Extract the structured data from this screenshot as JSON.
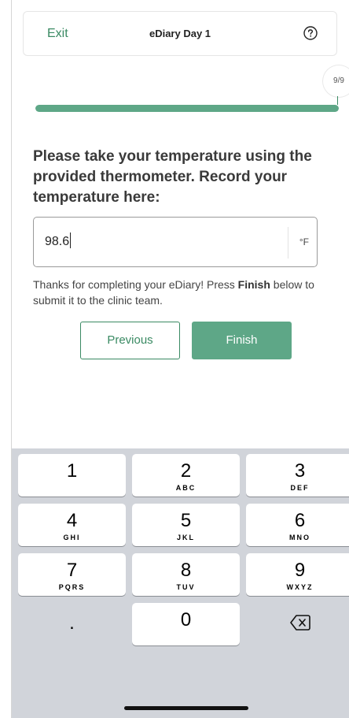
{
  "header": {
    "exit_label": "Exit",
    "title": "eDiary Day 1",
    "help_icon": "question-circle-icon"
  },
  "progress": {
    "label": "9/9",
    "fraction": 1.0,
    "color": "#5ea787"
  },
  "question": {
    "text": "Please take your temperature using the provided thermometer. Record your temperature here:"
  },
  "answer": {
    "value": "98.6",
    "unit": "°F"
  },
  "note": {
    "prefix": "Thanks for completing your eDiary! Press ",
    "bold": "Finish",
    "suffix": " below to submit it to the clinic team."
  },
  "buttons": {
    "previous": "Previous",
    "finish": "Finish"
  },
  "keyboard": {
    "keys": [
      {
        "digit": "1",
        "letters": ""
      },
      {
        "digit": "2",
        "letters": "ABC"
      },
      {
        "digit": "3",
        "letters": "DEF"
      },
      {
        "digit": "4",
        "letters": "GHI"
      },
      {
        "digit": "5",
        "letters": "JKL"
      },
      {
        "digit": "6",
        "letters": "MNO"
      },
      {
        "digit": "7",
        "letters": "PQRS"
      },
      {
        "digit": "8",
        "letters": "TUV"
      },
      {
        "digit": "9",
        "letters": "WXYZ"
      },
      {
        "digit": ".",
        "letters": ""
      },
      {
        "digit": "0",
        "letters": ""
      },
      {
        "digit": "",
        "letters": ""
      }
    ],
    "backspace_icon": "backspace-icon"
  },
  "colors": {
    "accent": "#3a8a63",
    "finish_button": "#5ea787",
    "keyboard_bg": "#d1d4da"
  }
}
